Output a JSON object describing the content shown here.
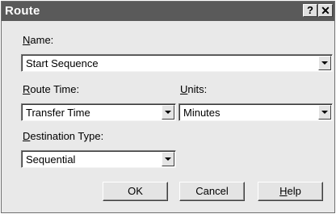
{
  "window": {
    "title": "Route",
    "help_glyph": "?",
    "close_glyph": "✕"
  },
  "name": {
    "label_accel": "N",
    "label_rest": "ame:",
    "value": "Start Sequence"
  },
  "route_time": {
    "label_accel": "R",
    "label_rest": "oute Time:",
    "value": "Transfer Time"
  },
  "units": {
    "label_accel": "U",
    "label_rest": "nits:",
    "value": "Minutes"
  },
  "destination_type": {
    "label_accel": "D",
    "label_rest": "estination Type:",
    "value": "Sequential"
  },
  "buttons": {
    "ok": "OK",
    "cancel": "Cancel",
    "help_accel": "H",
    "help_rest": "elp"
  }
}
